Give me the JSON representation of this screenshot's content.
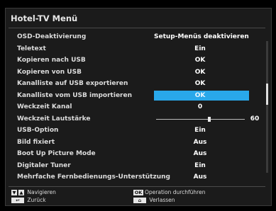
{
  "menu": {
    "title": "Hotel-TV Menü",
    "items": [
      {
        "label": "OSD-Deaktivierung",
        "value": "Setup-Menüs deaktivieren"
      },
      {
        "label": "Teletext",
        "value": "Ein"
      },
      {
        "label": "Kopieren nach USB",
        "value": "OK"
      },
      {
        "label": "Kopieren von USB",
        "value": "OK"
      },
      {
        "label": "Kanalliste auf USB exportieren",
        "value": "OK"
      },
      {
        "label": "Kanalliste vom USB importieren",
        "value": "OK",
        "selected": true
      },
      {
        "label": "Weckzeit Kanal",
        "value": "0"
      },
      {
        "label": "Weckzeit Lautstärke",
        "value": "60",
        "slider": 0.6
      },
      {
        "label": "USB-Option",
        "value": "Ein"
      },
      {
        "label": "Bild fixiert",
        "value": "Aus"
      },
      {
        "label": "Boot Up Picture Mode",
        "value": "Aus"
      },
      {
        "label": "Digitaler Tuner",
        "value": "Ein"
      },
      {
        "label": "Mehrfache Fernbedienungs-Unterstützung",
        "value": "Aus"
      }
    ]
  },
  "footer": {
    "navigate": "Navigieren",
    "back": "Zurück",
    "ok_key": "OK",
    "operate": "Operation durchführen",
    "exit": "Verlassen"
  }
}
